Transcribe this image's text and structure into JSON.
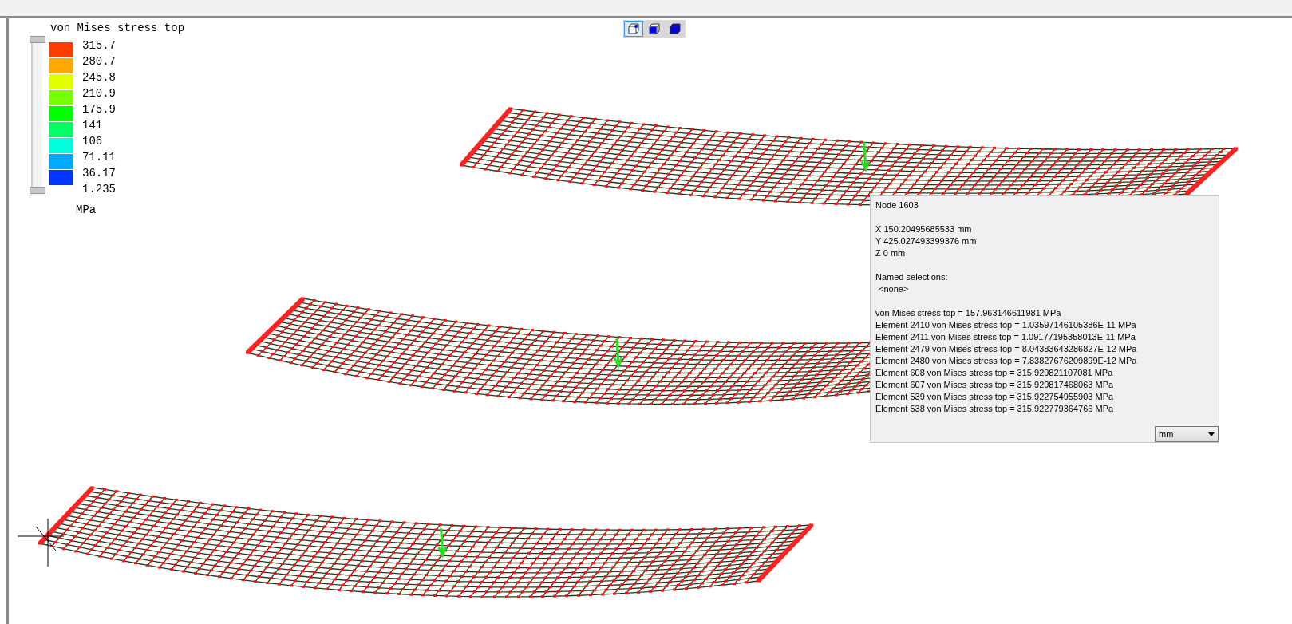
{
  "view_buttons": [
    {
      "selected": true
    },
    {
      "selected": false
    },
    {
      "selected": false
    }
  ],
  "legend": {
    "title": "von Mises stress top",
    "unit": "MPa",
    "bands": [
      {
        "color": "#ff3c00"
      },
      {
        "color": "#ffa800"
      },
      {
        "color": "#e4ff00"
      },
      {
        "color": "#78ff00"
      },
      {
        "color": "#00ff00"
      },
      {
        "color": "#00ff64"
      },
      {
        "color": "#00ffdc"
      },
      {
        "color": "#00aaff"
      },
      {
        "color": "#0037ff"
      }
    ],
    "range": {
      "level": 1
    },
    "ticks": [
      "315.7",
      "280.7",
      "245.8",
      "210.9",
      "175.9",
      "141",
      "106",
      "71.11",
      "36.17",
      "1.235"
    ]
  },
  "info_panel": {
    "node": "Node  1603",
    "coordinates": [
      "X  150.20495685533 mm",
      "Y  425.027493399376 mm",
      "Z  0 mm"
    ],
    "named_selections_label": "Named selections:",
    "named_selections": [
      "<none>"
    ],
    "results": [
      "von Mises stress top = 157.963146611981 MPa",
      "Element 2410 von Mises stress top = 1.03597146105386E-11 MPa",
      "Element 2411 von Mises stress top = 1.09177195358013E-11 MPa",
      "Element 2479 von Mises stress top = 8.04383643286827E-12 MPa",
      "Element 2480 von Mises stress top = 7.83827676209899E-12 MPa",
      "Element 608 von Mises stress top = 315.929821107081 MPa",
      "Element 607 von Mises stress top = 315.929817468063 MPa",
      "Element 539 von Mises stress top = 315.922754955903 MPa",
      "Element 538 von Mises stress top = 315.922779364766 MPa"
    ],
    "unit_select": "mm"
  }
}
